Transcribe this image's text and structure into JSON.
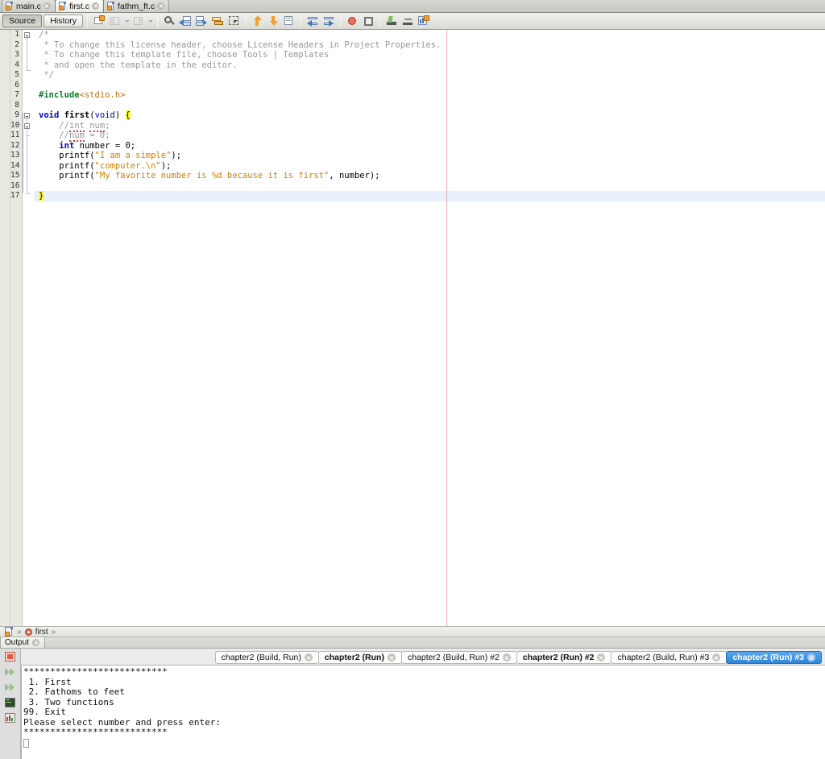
{
  "editor_tabs": [
    {
      "label": "main.c",
      "active": false,
      "icon": "c-file-icon"
    },
    {
      "label": "first.c",
      "active": true,
      "icon": "c-file-icon"
    },
    {
      "label": "fathm_ft.c",
      "active": false,
      "icon": "c-file-icon"
    }
  ],
  "toolbar": {
    "source_label": "Source",
    "history_label": "History",
    "buttons": [
      {
        "name": "refactor-icon",
        "enabled": true
      },
      {
        "name": "undo-icon",
        "enabled": false
      },
      {
        "name": "redo-icon",
        "enabled": false
      },
      {
        "name": "find-selection-icon",
        "enabled": true
      },
      {
        "name": "previous-bookmark-icon",
        "enabled": true
      },
      {
        "name": "next-bookmark-icon",
        "enabled": true
      },
      {
        "name": "toggle-bookmark-icon",
        "enabled": true
      },
      {
        "name": "toggle-rectangular-selection-icon",
        "enabled": true
      },
      {
        "name": "shift-line-up-icon",
        "enabled": true
      },
      {
        "name": "shift-line-down-icon",
        "enabled": true
      },
      {
        "name": "comment-icon",
        "enabled": true
      },
      {
        "name": "shift-line-left-icon",
        "enabled": true
      },
      {
        "name": "shift-line-right-icon",
        "enabled": true
      },
      {
        "name": "toggle-breakpoint-icon",
        "enabled": true
      },
      {
        "name": "stop-icon",
        "enabled": true
      },
      {
        "name": "last-edit-icon",
        "enabled": true
      },
      {
        "name": "inspect-icon",
        "enabled": true
      },
      {
        "name": "profile-icon",
        "enabled": true
      }
    ]
  },
  "code": {
    "lines": [
      {
        "n": "1",
        "tokens": [
          {
            "t": "/*",
            "c": "cmt"
          }
        ]
      },
      {
        "n": "2",
        "tokens": [
          {
            "t": " * To change this license header, choose License Headers in Project Properties.",
            "c": "cmt"
          }
        ]
      },
      {
        "n": "3",
        "tokens": [
          {
            "t": " * To change this template file, choose Tools | Templates",
            "c": "cmt"
          }
        ]
      },
      {
        "n": "4",
        "tokens": [
          {
            "t": " * and open the template in the editor.",
            "c": "cmt"
          }
        ]
      },
      {
        "n": "5",
        "tokens": [
          {
            "t": " */",
            "c": "cmt"
          }
        ]
      },
      {
        "n": "6",
        "tokens": []
      },
      {
        "n": "7",
        "tokens": [
          {
            "t": "#include",
            "c": "pre"
          },
          {
            "t": "<stdio.h>",
            "c": "inc"
          }
        ]
      },
      {
        "n": "8",
        "tokens": []
      },
      {
        "n": "9",
        "tokens": [
          {
            "t": "void",
            "c": "kw"
          },
          {
            "t": " ",
            "c": ""
          },
          {
            "t": "first",
            "c": "bold"
          },
          {
            "t": "(",
            "c": ""
          },
          {
            "t": "void",
            "c": "kw2"
          },
          {
            "t": ") ",
            "c": ""
          },
          {
            "t": "{",
            "c": "yhl"
          }
        ]
      },
      {
        "n": "10",
        "tokens": [
          {
            "t": "    //",
            "c": "cmt"
          },
          {
            "t": "int",
            "c": "cmtsq"
          },
          {
            "t": " ",
            "c": "cmt"
          },
          {
            "t": "num",
            "c": "cmtsq"
          },
          {
            "t": ";",
            "c": "cmt"
          }
        ]
      },
      {
        "n": "11",
        "tokens": [
          {
            "t": "    //",
            "c": "cmt"
          },
          {
            "t": "num",
            "c": "cmtsq"
          },
          {
            "t": " = 0;",
            "c": "cmt"
          }
        ]
      },
      {
        "n": "12",
        "tokens": [
          {
            "t": "    ",
            "c": ""
          },
          {
            "t": "int",
            "c": "kw"
          },
          {
            "t": " number = 0;",
            "c": ""
          }
        ]
      },
      {
        "n": "13",
        "tokens": [
          {
            "t": "    printf(",
            "c": ""
          },
          {
            "t": "\"I am a simple\"",
            "c": "str"
          },
          {
            "t": ");",
            "c": ""
          }
        ]
      },
      {
        "n": "14",
        "tokens": [
          {
            "t": "    printf(",
            "c": ""
          },
          {
            "t": "\"computer.\\n\"",
            "c": "str"
          },
          {
            "t": ");",
            "c": ""
          }
        ]
      },
      {
        "n": "15",
        "tokens": [
          {
            "t": "    printf(",
            "c": ""
          },
          {
            "t": "\"My favorite number is %d because it is first\"",
            "c": "str"
          },
          {
            "t": ", number);",
            "c": ""
          }
        ]
      },
      {
        "n": "16",
        "tokens": []
      },
      {
        "n": "17",
        "tokens": [
          {
            "t": "}",
            "c": "yhl"
          }
        ],
        "highlight": true
      }
    ]
  },
  "breadcrumb": {
    "file_icon": "c-file-icon",
    "separator": "»",
    "method_icon": "method-icon",
    "method": "first"
  },
  "output_window": {
    "title": "Output",
    "side_buttons": [
      {
        "name": "stop-process-icon"
      },
      {
        "name": "rerun-icon"
      },
      {
        "name": "rerun-alternate-icon"
      },
      {
        "name": "open-terminal-icon"
      },
      {
        "name": "statistics-icon"
      }
    ],
    "run_tabs": [
      {
        "label": "chapter2 (Build, Run)",
        "bold": false,
        "selected": false
      },
      {
        "label": "chapter2 (Run)",
        "bold": true,
        "selected": false
      },
      {
        "label": "chapter2 (Build, Run) #2",
        "bold": false,
        "selected": false
      },
      {
        "label": "chapter2 (Run) #2",
        "bold": true,
        "selected": false
      },
      {
        "label": "chapter2 (Build, Run) #3",
        "bold": false,
        "selected": false
      },
      {
        "label": "chapter2 (Run) #3",
        "bold": true,
        "selected": true
      }
    ],
    "console_lines": [
      "***************************",
      " 1. First",
      " 2. Fathoms to feet",
      " 3. Two functions",
      "99. Exit",
      "Please select number and press enter:",
      "***************************"
    ]
  }
}
